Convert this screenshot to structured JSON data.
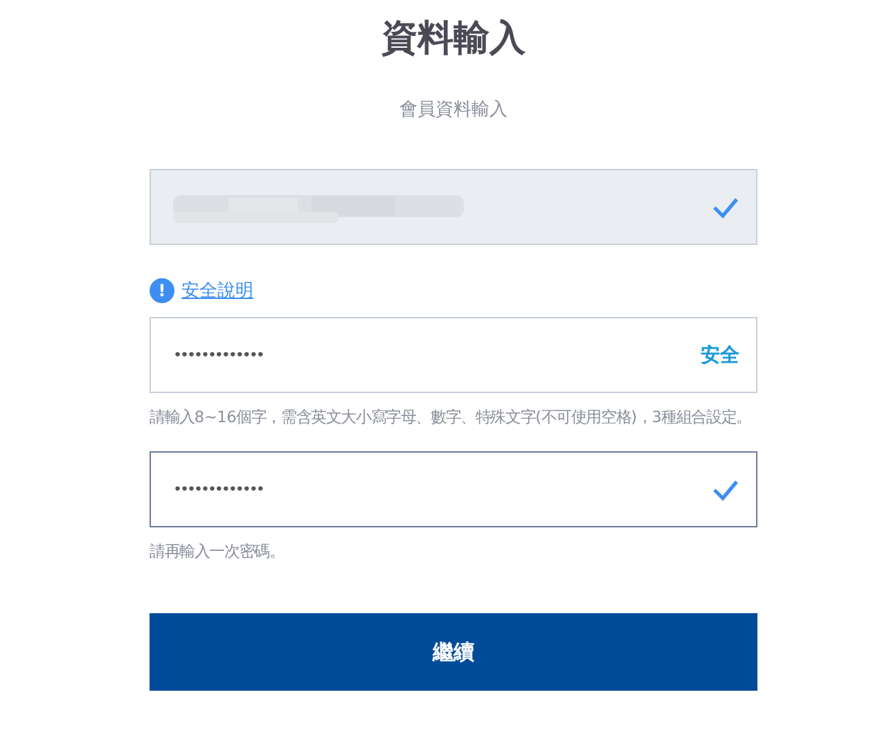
{
  "title": "資料輸入",
  "subtitle": "會員資料輸入",
  "fields": [
    {
      "kind": "masked",
      "disabled": true,
      "focused": false,
      "status": {
        "kind": "check"
      }
    },
    {
      "kind": "link",
      "icon": "!",
      "label": "安全說明"
    },
    {
      "kind": "input",
      "value": "•••••••••••••",
      "disabled": false,
      "focused": false,
      "status": {
        "kind": "text",
        "text": "安全"
      }
    },
    {
      "kind": "hint",
      "text": "請輸入8~16個字，需含英文大小寫字母、數字、特殊文字(不可使用空格)，3種組合設定。"
    },
    {
      "kind": "input",
      "value": "•••••••••••••",
      "disabled": false,
      "focused": true,
      "status": {
        "kind": "check"
      }
    },
    {
      "kind": "hint",
      "text": "請再輸入一次密碼。"
    }
  ],
  "button": "繼續"
}
